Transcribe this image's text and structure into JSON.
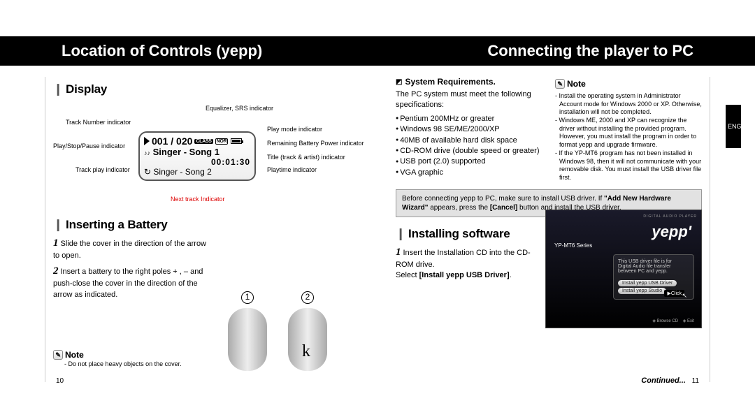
{
  "header": {
    "left_title": "Location of Controls (yepp)",
    "right_title": "Connecting the player to PC"
  },
  "left_page": {
    "display_section": {
      "heading": "Display",
      "callouts": {
        "track_number": "Track Number indicator",
        "play_stop": "Play/Stop/Pause indicator",
        "track_play": "Track play indicator",
        "eq_srs": "Equalizer, SRS indicator",
        "play_mode": "Play mode indicator",
        "battery": "Remaining Battery Power indicator",
        "title": "Title (track & artist) indicator",
        "playtime": "Playtime indicator",
        "next_track": "Next track  Indicator"
      },
      "lcd": {
        "counter": "001 / 020",
        "badge1": "CLASS",
        "badge2": "NOR",
        "row2_prefix": "♪♪",
        "row2": "Singer - Song 1",
        "row3": "00:01:30",
        "row4_prefix": "↻",
        "row4": "Singer - Song 2"
      }
    },
    "battery_section": {
      "heading": "Inserting a Battery",
      "step1": "Slide the cover in the direction of the arrow to open.",
      "step2": "Insert a battery to the right poles + , – and push-close the cover in the direction of the arrow as indicated.",
      "fig1": "①",
      "fig2": "②",
      "k": "k"
    },
    "note": {
      "label": "Note",
      "text": "Do not place heavy objects on the cover."
    },
    "page_number": "10"
  },
  "right_page": {
    "sysreq": {
      "heading": "System Requirements.",
      "intro": "The PC system must meet the following specifications:",
      "items": [
        "Pentium 200MHz or greater",
        "Windows 98 SE/ME/2000/XP",
        "40MB of available hard disk space",
        "CD-ROM drive (double speed or greater)",
        "USB port (2.0) supported",
        "VGA graphic"
      ]
    },
    "note": {
      "label": "Note",
      "items": [
        "Install the operating system in Administrator Account mode for Windows 2000 or XP. Otherwise, installation will not be completed.",
        "Windows ME, 2000 and XP can recognize the driver without installing the provided program. However, you must install the program in order to format yepp and upgrade firmware.",
        "If the YP-MT6 program has not been installed in Windows 98, then it will not communicate with your removable disk. You must install the USB driver file first."
      ]
    },
    "graybox": {
      "line1": "Before connecting yepp to PC, make sure to install USB driver. If ",
      "bold1": "\"Add New Hardware Wizard\"",
      "line2": " appears, press the ",
      "bold2": "[Cancel]",
      "line3": " button and install the USB driver."
    },
    "install": {
      "heading": "Installing software",
      "step1a": "Insert the Installation CD into the CD-ROM drive.",
      "step1b_prefix": "Select ",
      "step1b_bold": "[Install yepp USB Driver]",
      "step1b_suffix": "."
    },
    "screenshot": {
      "pretitle": "DIGITAL AUDIO PLAYER",
      "logo": "yepp'",
      "model": "YP-MT6 Series",
      "desc1": "This USB driver file is for",
      "desc2": "Digital Audio file transfer",
      "desc3": "between PC and yepp.",
      "btn1": "Install yepp USB Driver",
      "btn2": "Install yepp Studio",
      "foot1": "Browse CD",
      "foot2": "Exit",
      "click": "Click"
    },
    "eng_tab": "ENG",
    "continued": "Continued...",
    "page_number": "11"
  }
}
